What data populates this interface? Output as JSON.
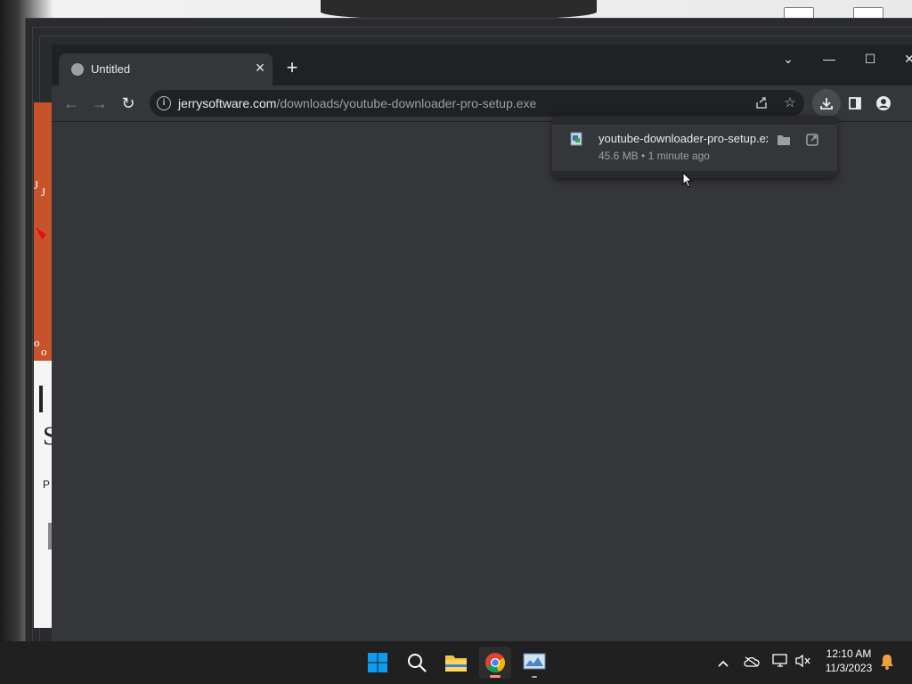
{
  "tab": {
    "title": "Untitled",
    "close": "×",
    "new_tab": "+"
  },
  "window_controls": {
    "tabsearch": "⌄",
    "minimize": "—",
    "maximize": "☐",
    "close": "✕"
  },
  "toolbar": {
    "back": "←",
    "forward": "→",
    "reload": "↻"
  },
  "address": {
    "host": "jerrysoftware.com",
    "path": "/downloads/youtube-downloader-pro-setup.exe"
  },
  "download_bubble": {
    "file_name": "youtube-downloader-pro-setup.exe",
    "size": "45.6 MB",
    "time": "1 minute ago",
    "separator": "•"
  },
  "background": {
    "strip_text_top": "J",
    "strip_text_top2": "J",
    "strip_text_mid": "o",
    "strip_text_mid2": "o",
    "strip_text_s": "S",
    "strip_text_p": "P"
  },
  "taskbar": {
    "time": "12:10 AM",
    "date": "11/3/2023"
  },
  "colors": {
    "chrome_dark": "#202124",
    "chrome_surface": "#35363a",
    "taskbar": "#202020",
    "accent": "#4cc2ff"
  },
  "icons": [
    "info-icon",
    "share-icon",
    "star-icon",
    "download-icon",
    "sidepanel-icon",
    "profile-icon",
    "folder-icon",
    "open-external-icon",
    "windows-start-icon",
    "search-icon",
    "file-explorer-icon",
    "chrome-icon",
    "app-icon",
    "chevron-up-icon",
    "onedrive-icon",
    "network-icon",
    "volume-muted-icon",
    "notification-bell-icon"
  ]
}
